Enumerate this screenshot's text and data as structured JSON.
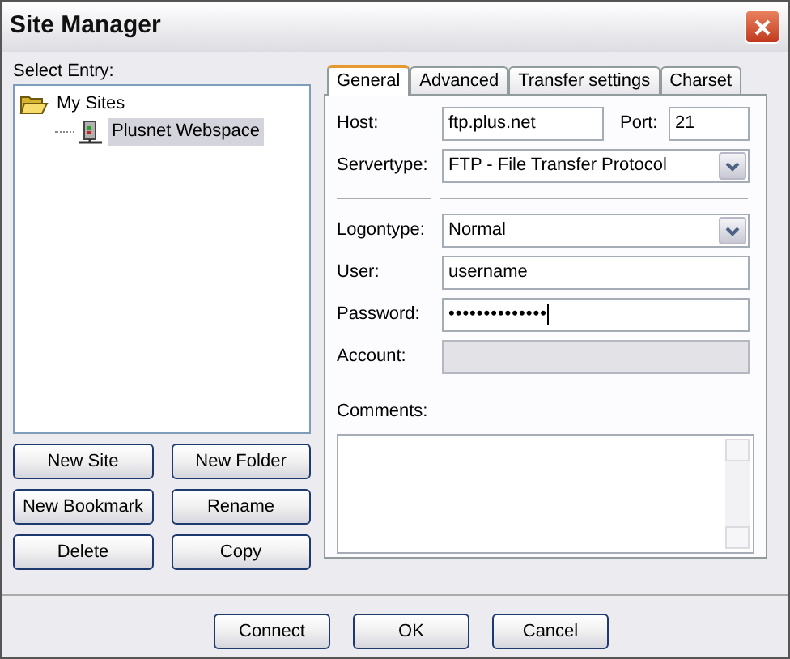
{
  "window": {
    "title": "Site Manager"
  },
  "select_entry_label": "Select Entry:",
  "tree": [
    {
      "label": "My Sites",
      "expanded": true,
      "selected": false,
      "children": [
        {
          "label": "Plusnet Webspace",
          "selected": true
        }
      ]
    }
  ],
  "entry_buttons": [
    "New Site",
    "New Folder",
    "New Bookmark",
    "Rename",
    "Delete",
    "Copy"
  ],
  "tabs": [
    {
      "label": "General",
      "selected": true
    },
    {
      "label": "Advanced",
      "selected": false
    },
    {
      "label": "Transfer settings",
      "selected": false
    },
    {
      "label": "Charset",
      "selected": false
    }
  ],
  "general": {
    "host_label": "Host:",
    "host": "ftp.plus.net",
    "port_label": "Port:",
    "port": "21",
    "servertype_label": "Servertype:",
    "servertype": "FTP - File Transfer Protocol",
    "logontype_label": "Logontype:",
    "logontype": "Normal",
    "user_label": "User:",
    "user": "username",
    "password_label": "Password:",
    "password": "••••••••••••••",
    "account_label": "Account:",
    "account_disabled": true,
    "comments_label": "Comments:"
  },
  "dialog_buttons": [
    "Connect",
    "OK",
    "Cancel"
  ]
}
